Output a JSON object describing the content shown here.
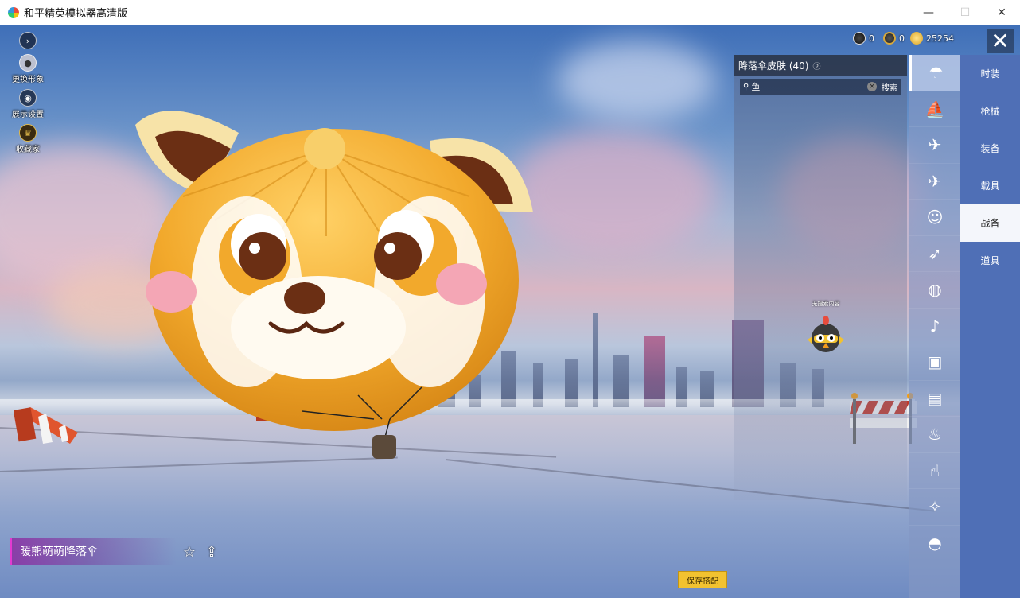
{
  "window": {
    "title": "和平精英模拟器高清版",
    "minimize": "—",
    "maximize": "☐",
    "close": "✕"
  },
  "left_menu": [
    {
      "label": "更换形象",
      "icon": "avatar-icon"
    },
    {
      "label": "展示设置",
      "icon": "eye-icon"
    },
    {
      "label": "收藏家",
      "icon": "collector-badge-icon"
    }
  ],
  "currency": [
    {
      "icon": "black-coin-icon",
      "amount": "0"
    },
    {
      "icon": "gold-badge-icon",
      "amount": "0"
    },
    {
      "icon": "gold-coin-icon",
      "amount": "25254"
    }
  ],
  "close_symbol": "✕",
  "panel": {
    "title": "降落伞皮肤 (40)",
    "info_icon": "ⓟ",
    "search_value": "鱼",
    "search_button": "搜索",
    "empty_message": "无搜索内容"
  },
  "categories": [
    {
      "icon": "parachute-icon",
      "active": true
    },
    {
      "icon": "boat-icon"
    },
    {
      "icon": "drone-icon"
    },
    {
      "icon": "plane-icon"
    },
    {
      "icon": "emote-face-icon"
    },
    {
      "icon": "glider-icon"
    },
    {
      "icon": "backpack-icon"
    },
    {
      "icon": "speaker-icon"
    },
    {
      "icon": "sticker-icon"
    },
    {
      "icon": "photo-icon"
    },
    {
      "icon": "extinguisher-icon"
    },
    {
      "icon": "hand-tap-icon"
    },
    {
      "icon": "magic-wand-icon"
    },
    {
      "icon": "ufo-icon"
    }
  ],
  "tabs": [
    {
      "label": "时装"
    },
    {
      "label": "枪械"
    },
    {
      "label": "装备"
    },
    {
      "label": "载具"
    },
    {
      "label": "战备",
      "active": true
    },
    {
      "label": "道具"
    }
  ],
  "item_name": "暖熊萌萌降落伞",
  "favorite_icon": "☆",
  "share_icon": "⇪",
  "save_button": "保存搭配",
  "colors": {
    "tab_bg": "#4f6fb6",
    "accent_gold": "#f2c230",
    "name_bar": "#8c28a0"
  }
}
